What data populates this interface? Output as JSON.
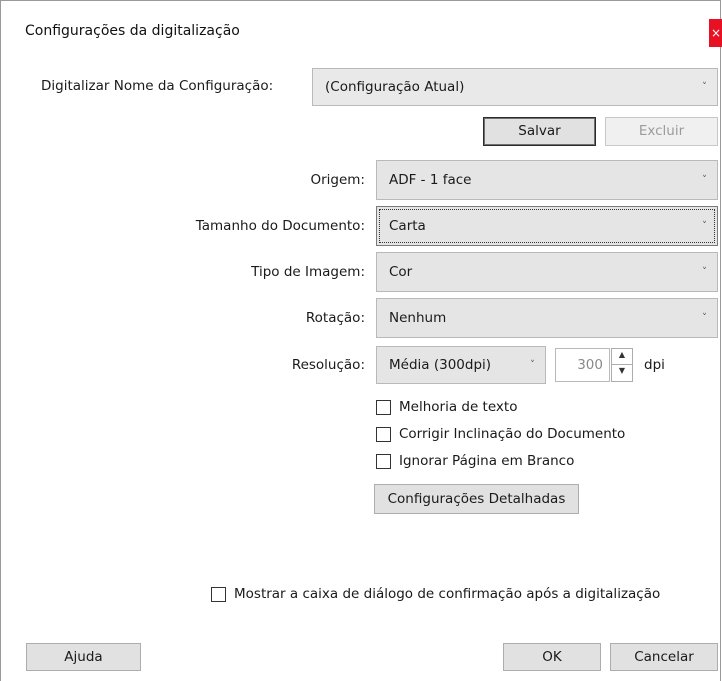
{
  "window": {
    "title": "Configurações da digitalização",
    "close_glyph": "×"
  },
  "config_name": {
    "label": "Digitalizar Nome da Configuração:",
    "value": "(Configuração Atual)"
  },
  "buttons": {
    "save": "Salvar",
    "delete": "Excluir",
    "detailed": "Configurações Detalhadas",
    "help": "Ajuda",
    "ok": "OK",
    "cancel": "Cancelar"
  },
  "source": {
    "label": "Origem:",
    "value": "ADF - 1 face"
  },
  "doc_size": {
    "label": "Tamanho do Documento:",
    "value": "Carta"
  },
  "image_type": {
    "label": "Tipo de Imagem:",
    "value": "Cor"
  },
  "rotation": {
    "label": "Rotação:",
    "value": "Nenhum"
  },
  "resolution": {
    "label": "Resolução:",
    "value": "Média (300dpi)",
    "dpi_value": "300",
    "unit": "dpi"
  },
  "options": {
    "text_enhancement": "Melhoria de texto",
    "correct_skew": "Corrigir Inclinação do Documento",
    "skip_blank": "Ignorar Página em Branco"
  },
  "confirm_dialog": "Mostrar a caixa de diálogo de confirmação após a digitalização",
  "icons": {
    "chevron": "˅",
    "up": "▲",
    "down": "▼"
  }
}
